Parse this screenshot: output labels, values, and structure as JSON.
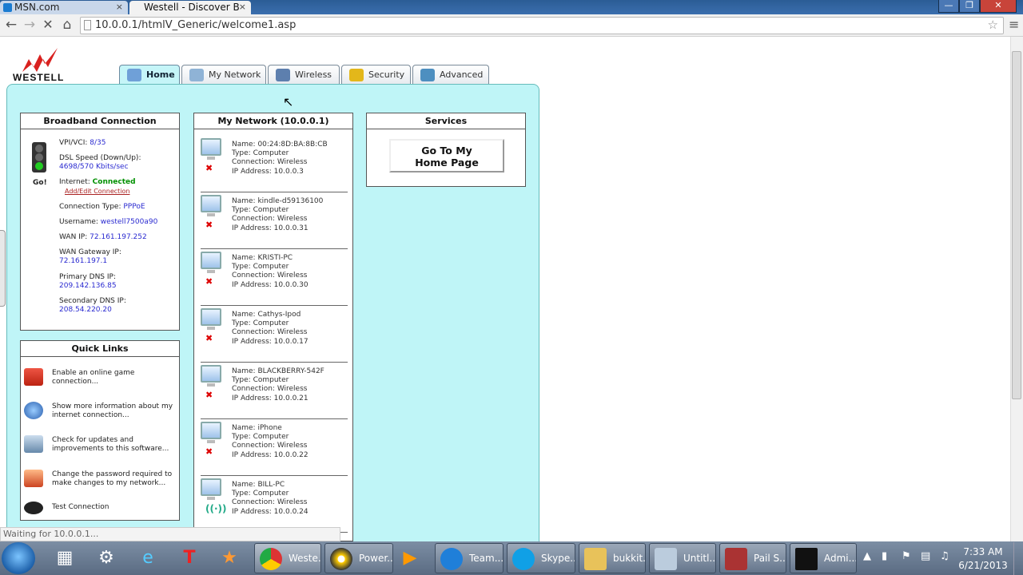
{
  "browser": {
    "tabs": [
      {
        "label": "MSN.com",
        "close": "×"
      },
      {
        "label": "Westell - Discover B",
        "close": "×"
      }
    ],
    "window_controls": [
      "—",
      "❐",
      "✕"
    ],
    "url": "10.0.0.1/htmlV_Generic/welcome1.asp",
    "status": "Waiting for 10.0.0.1..."
  },
  "router": {
    "logo_text": "WESTELL",
    "tabs": [
      "Home",
      "My Network",
      "Wireless",
      "Security",
      "Advanced"
    ]
  },
  "broadband": {
    "title": "Broadband Connection",
    "go_label": "Go!",
    "vpi_label": "VPI/VCI:",
    "vpi_value": "8/35",
    "dsl_label": "DSL Speed (Down/Up):",
    "dsl_value": "4698/570 Kbits/sec",
    "internet_label": "Internet:",
    "internet_value": "Connected",
    "add_edit": "Add/Edit Connection",
    "conn_type_label": "Connection Type:",
    "conn_type_value": "PPPoE",
    "username_label": "Username:",
    "username_value": "westell7500a90",
    "wan_ip_label": "WAN IP:",
    "wan_ip_value": "72.161.197.252",
    "gateway_label": "WAN Gateway IP:",
    "gateway_value": "72.161.197.1",
    "pdns_label": "Primary DNS IP:",
    "pdns_value": "209.142.136.85",
    "sdns_label": "Secondary DNS IP:",
    "sdns_value": "208.54.220.20"
  },
  "quick_links": {
    "title": "Quick Links",
    "items": [
      {
        "l1": "Enable an online game",
        "l2": "connection..."
      },
      {
        "l1": "Show more information about my",
        "l2": "internet connection..."
      },
      {
        "l1": "Check for updates and",
        "l2": "improvements to this software..."
      },
      {
        "l1": "Change the password required to",
        "l2": "make changes to my network..."
      },
      {
        "l1": "Test Connection",
        "l2": ""
      }
    ]
  },
  "my_network": {
    "title": "My Network (10.0.0.1)",
    "devices": [
      {
        "name": "Name: 00:24:8D:BA:8B:CB",
        "type": "Type: Computer",
        "conn": "Connection: Wireless",
        "ip": "IP Address: 10.0.0.3"
      },
      {
        "name": "Name: kindle-d59136100",
        "type": "Type: Computer",
        "conn": "Connection: Wireless",
        "ip": "IP Address: 10.0.0.31"
      },
      {
        "name": "Name: KRISTI-PC",
        "type": "Type: Computer",
        "conn": "Connection: Wireless",
        "ip": "IP Address: 10.0.0.30"
      },
      {
        "name": "Name: Cathys-Ipod",
        "type": "Type: Computer",
        "conn": "Connection: Wireless",
        "ip": "IP Address: 10.0.0.17"
      },
      {
        "name": "Name: BLACKBERRY-542F",
        "type": "Type: Computer",
        "conn": "Connection: Wireless",
        "ip": "IP Address: 10.0.0.21"
      },
      {
        "name": "Name: iPhone",
        "type": "Type: Computer",
        "conn": "Connection: Wireless",
        "ip": "IP Address: 10.0.0.22"
      },
      {
        "name": "Name: BILL-PC",
        "type": "Type: Computer",
        "conn": "Connection: Wireless",
        "ip": "IP Address: 10.0.0.24"
      }
    ]
  },
  "services": {
    "title": "Services",
    "button_l1": "Go To My",
    "button_l2": "Home Page"
  },
  "taskbar": {
    "items": [
      "Weste...",
      "Power...",
      "Team...",
      "Skype...",
      "bukkit...",
      "Untitl...",
      "Pail S...",
      "Admi..."
    ],
    "time": "7:33 AM",
    "date": "6/21/2013"
  }
}
